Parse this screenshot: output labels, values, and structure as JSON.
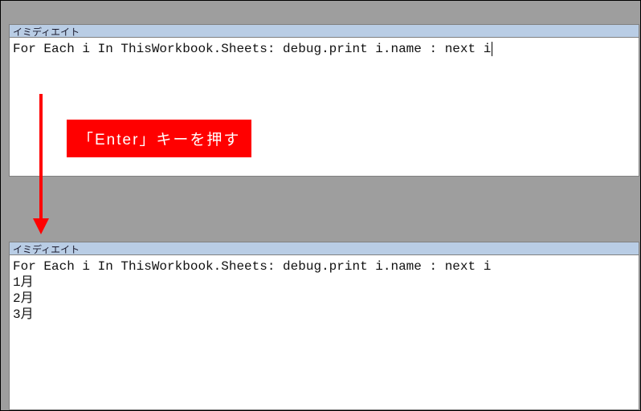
{
  "pane1": {
    "title": "イミディエイト",
    "code": "For Each i In ThisWorkbook.Sheets: debug.print i.name : next i"
  },
  "callout": {
    "text": "「Enter」キーを押す"
  },
  "pane2": {
    "title": "イミディエイト",
    "code": "For Each i In ThisWorkbook.Sheets: debug.print i.name : next i",
    "output": [
      "1月",
      "2月",
      "3月"
    ]
  },
  "colors": {
    "titlebar": "#b9cde5",
    "callout_bg": "#ff0000",
    "callout_fg": "#ffffff",
    "arrow": "#ff0000",
    "background": "#9e9e9e"
  }
}
